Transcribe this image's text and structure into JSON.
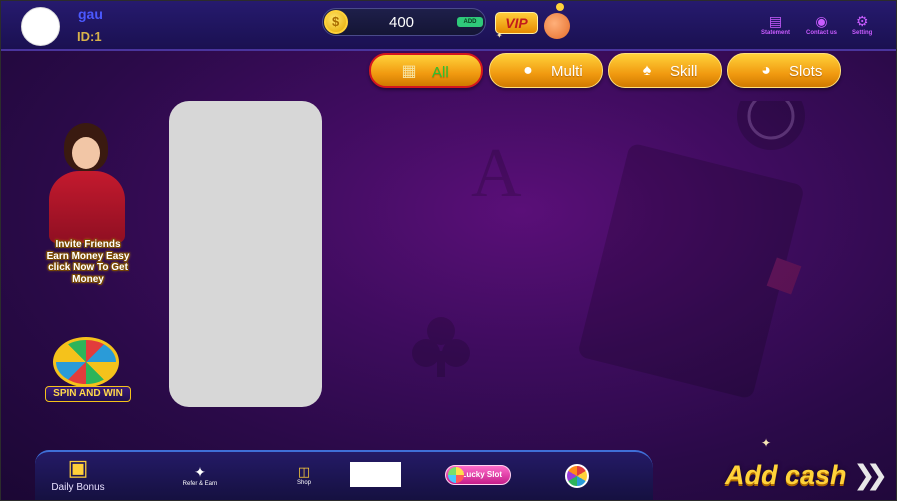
{
  "user": {
    "name": "gau",
    "id": "ID:1"
  },
  "balance": {
    "value": "400",
    "add_label": "ADD",
    "coin_icon": "coin-icon"
  },
  "vip": {
    "label": "VIP"
  },
  "header_actions": [
    {
      "label": "Statement",
      "icon": "scroll-icon"
    },
    {
      "label": "Contact us",
      "icon": "headset-icon"
    },
    {
      "label": "Setting",
      "icon": "gear-icon"
    }
  ],
  "tabs": [
    {
      "label": "All",
      "icon": "grid-icon",
      "active": true
    },
    {
      "label": "Multi",
      "icon": "group-icon",
      "active": false
    },
    {
      "label": "Skill",
      "icon": "cards-icon",
      "active": false
    },
    {
      "label": "Slots",
      "icon": "ball-icon",
      "active": false
    }
  ],
  "promos": {
    "invite": {
      "lines": [
        "Invite Friends",
        "Earn Money Easy",
        "click Now To Get",
        "Money"
      ]
    },
    "spin": {
      "label": "SPIN AND WIN"
    }
  },
  "bottom_bar": {
    "daily_bonus": "Daily Bonus",
    "refer_earn": "Refer & Earn",
    "shop": "Shop",
    "lucky_slot": "Lucky Slot"
  },
  "add_cash": {
    "label": "Add cash"
  },
  "colors": {
    "accent_gold": "#f19a10",
    "active_tab_text": "#2ec22e",
    "active_tab_border": "#d4161e",
    "username": "#4b59ff",
    "header_bg": "#1a1050",
    "background": "#3e0c5e"
  }
}
